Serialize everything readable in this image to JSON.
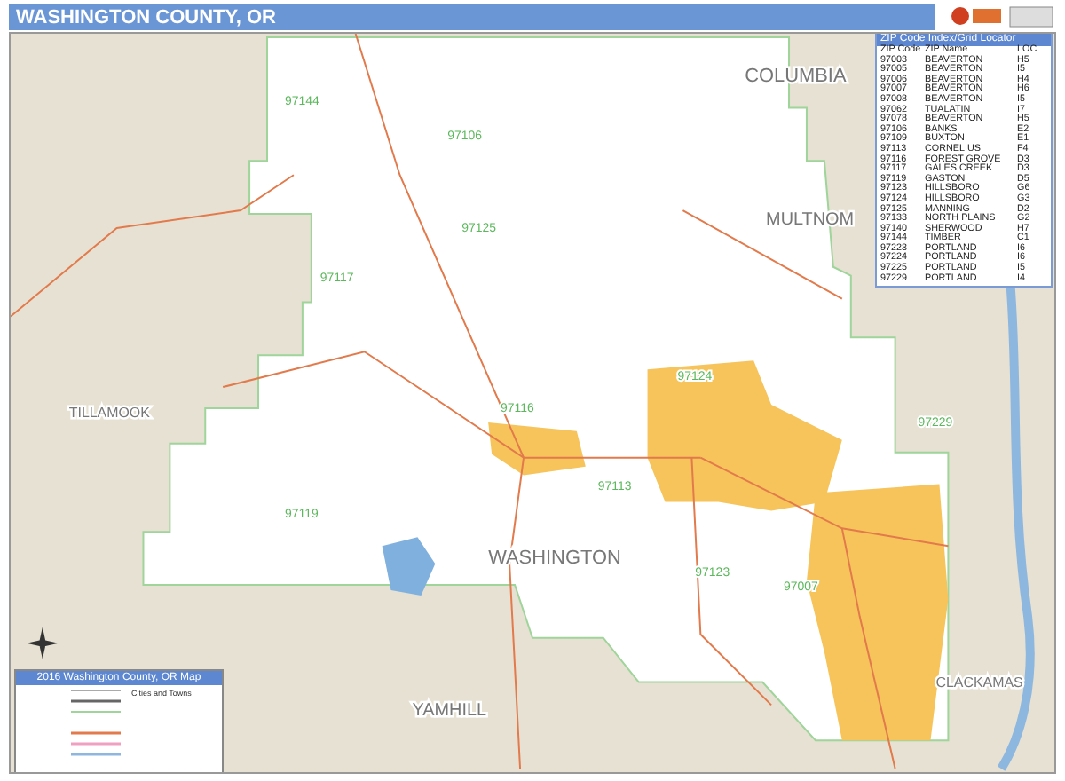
{
  "title": "WASHINGTON COUNTY, OR",
  "map": {
    "regions": [
      {
        "label": "COLUMBIA"
      },
      {
        "label": "MULTNOM"
      },
      {
        "label": "TILLAMOOK"
      },
      {
        "label": "WASHINGTON"
      },
      {
        "label": "YAMHILL"
      },
      {
        "label": "CLACKAMAS"
      }
    ],
    "zip_labels": [
      "97144",
      "97106",
      "97125",
      "97117",
      "97124",
      "97116",
      "97113",
      "97119",
      "97123",
      "97229",
      "97007"
    ]
  },
  "zip_index": {
    "title": "ZIP Code Index/Grid Locator",
    "columns": [
      "ZIP Code",
      "ZIP Name",
      "LOC"
    ],
    "rows": [
      [
        "97003",
        "BEAVERTON",
        "H5"
      ],
      [
        "97005",
        "BEAVERTON",
        "I5"
      ],
      [
        "97006",
        "BEAVERTON",
        "H4"
      ],
      [
        "97007",
        "BEAVERTON",
        "H6"
      ],
      [
        "97008",
        "BEAVERTON",
        "I5"
      ],
      [
        "97062",
        "TUALATIN",
        "I7"
      ],
      [
        "97078",
        "BEAVERTON",
        "H5"
      ],
      [
        "97106",
        "BANKS",
        "E2"
      ],
      [
        "97109",
        "BUXTON",
        "E1"
      ],
      [
        "97113",
        "CORNELIUS",
        "F4"
      ],
      [
        "97116",
        "FOREST GROVE",
        "D3"
      ],
      [
        "97117",
        "GALES CREEK",
        "D3"
      ],
      [
        "97119",
        "GASTON",
        "D5"
      ],
      [
        "97123",
        "HILLSBORO",
        "G6"
      ],
      [
        "97124",
        "HILLSBORO",
        "G3"
      ],
      [
        "97125",
        "MANNING",
        "D2"
      ],
      [
        "97133",
        "NORTH PLAINS",
        "G2"
      ],
      [
        "97140",
        "SHERWOOD",
        "H7"
      ],
      [
        "97144",
        "TIMBER",
        "C1"
      ],
      [
        "97223",
        "PORTLAND",
        "I6"
      ],
      [
        "97224",
        "PORTLAND",
        "I6"
      ],
      [
        "97225",
        "PORTLAND",
        "I5"
      ],
      [
        "97229",
        "PORTLAND",
        "I4"
      ]
    ]
  },
  "legend": {
    "title": "2016 Washington County, OR Map",
    "subtitle": "Cities and Towns"
  }
}
